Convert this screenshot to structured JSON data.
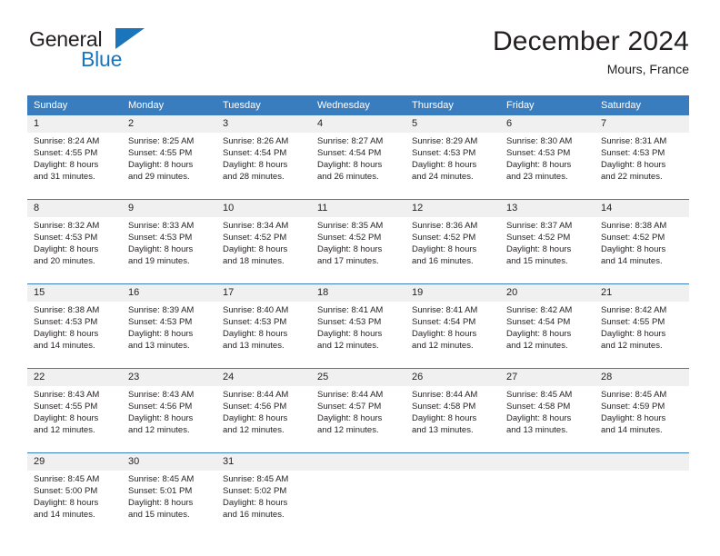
{
  "logo": {
    "word_general": "General",
    "word_blue": "Blue",
    "triangle_color": "#1b75bb"
  },
  "header": {
    "month_title": "December 2024",
    "location": "Mours, France"
  },
  "theme": {
    "header_blue": "#3a7dbf",
    "day_band_gray": "#f0f0f0",
    "text": "#231f20",
    "page_background": "#ffffff"
  },
  "weekdays": [
    "Sunday",
    "Monday",
    "Tuesday",
    "Wednesday",
    "Thursday",
    "Friday",
    "Saturday"
  ],
  "weeks": [
    [
      {
        "day": "1",
        "sunrise": "Sunrise: 8:24 AM",
        "sunset": "Sunset: 4:55 PM",
        "daylight_line1": "Daylight: 8 hours",
        "daylight_line2": "and 31 minutes."
      },
      {
        "day": "2",
        "sunrise": "Sunrise: 8:25 AM",
        "sunset": "Sunset: 4:55 PM",
        "daylight_line1": "Daylight: 8 hours",
        "daylight_line2": "and 29 minutes."
      },
      {
        "day": "3",
        "sunrise": "Sunrise: 8:26 AM",
        "sunset": "Sunset: 4:54 PM",
        "daylight_line1": "Daylight: 8 hours",
        "daylight_line2": "and 28 minutes."
      },
      {
        "day": "4",
        "sunrise": "Sunrise: 8:27 AM",
        "sunset": "Sunset: 4:54 PM",
        "daylight_line1": "Daylight: 8 hours",
        "daylight_line2": "and 26 minutes."
      },
      {
        "day": "5",
        "sunrise": "Sunrise: 8:29 AM",
        "sunset": "Sunset: 4:53 PM",
        "daylight_line1": "Daylight: 8 hours",
        "daylight_line2": "and 24 minutes."
      },
      {
        "day": "6",
        "sunrise": "Sunrise: 8:30 AM",
        "sunset": "Sunset: 4:53 PM",
        "daylight_line1": "Daylight: 8 hours",
        "daylight_line2": "and 23 minutes."
      },
      {
        "day": "7",
        "sunrise": "Sunrise: 8:31 AM",
        "sunset": "Sunset: 4:53 PM",
        "daylight_line1": "Daylight: 8 hours",
        "daylight_line2": "and 22 minutes."
      }
    ],
    [
      {
        "day": "8",
        "sunrise": "Sunrise: 8:32 AM",
        "sunset": "Sunset: 4:53 PM",
        "daylight_line1": "Daylight: 8 hours",
        "daylight_line2": "and 20 minutes."
      },
      {
        "day": "9",
        "sunrise": "Sunrise: 8:33 AM",
        "sunset": "Sunset: 4:53 PM",
        "daylight_line1": "Daylight: 8 hours",
        "daylight_line2": "and 19 minutes."
      },
      {
        "day": "10",
        "sunrise": "Sunrise: 8:34 AM",
        "sunset": "Sunset: 4:52 PM",
        "daylight_line1": "Daylight: 8 hours",
        "daylight_line2": "and 18 minutes."
      },
      {
        "day": "11",
        "sunrise": "Sunrise: 8:35 AM",
        "sunset": "Sunset: 4:52 PM",
        "daylight_line1": "Daylight: 8 hours",
        "daylight_line2": "and 17 minutes."
      },
      {
        "day": "12",
        "sunrise": "Sunrise: 8:36 AM",
        "sunset": "Sunset: 4:52 PM",
        "daylight_line1": "Daylight: 8 hours",
        "daylight_line2": "and 16 minutes."
      },
      {
        "day": "13",
        "sunrise": "Sunrise: 8:37 AM",
        "sunset": "Sunset: 4:52 PM",
        "daylight_line1": "Daylight: 8 hours",
        "daylight_line2": "and 15 minutes."
      },
      {
        "day": "14",
        "sunrise": "Sunrise: 8:38 AM",
        "sunset": "Sunset: 4:52 PM",
        "daylight_line1": "Daylight: 8 hours",
        "daylight_line2": "and 14 minutes."
      }
    ],
    [
      {
        "day": "15",
        "sunrise": "Sunrise: 8:38 AM",
        "sunset": "Sunset: 4:53 PM",
        "daylight_line1": "Daylight: 8 hours",
        "daylight_line2": "and 14 minutes."
      },
      {
        "day": "16",
        "sunrise": "Sunrise: 8:39 AM",
        "sunset": "Sunset: 4:53 PM",
        "daylight_line1": "Daylight: 8 hours",
        "daylight_line2": "and 13 minutes."
      },
      {
        "day": "17",
        "sunrise": "Sunrise: 8:40 AM",
        "sunset": "Sunset: 4:53 PM",
        "daylight_line1": "Daylight: 8 hours",
        "daylight_line2": "and 13 minutes."
      },
      {
        "day": "18",
        "sunrise": "Sunrise: 8:41 AM",
        "sunset": "Sunset: 4:53 PM",
        "daylight_line1": "Daylight: 8 hours",
        "daylight_line2": "and 12 minutes."
      },
      {
        "day": "19",
        "sunrise": "Sunrise: 8:41 AM",
        "sunset": "Sunset: 4:54 PM",
        "daylight_line1": "Daylight: 8 hours",
        "daylight_line2": "and 12 minutes."
      },
      {
        "day": "20",
        "sunrise": "Sunrise: 8:42 AM",
        "sunset": "Sunset: 4:54 PM",
        "daylight_line1": "Daylight: 8 hours",
        "daylight_line2": "and 12 minutes."
      },
      {
        "day": "21",
        "sunrise": "Sunrise: 8:42 AM",
        "sunset": "Sunset: 4:55 PM",
        "daylight_line1": "Daylight: 8 hours",
        "daylight_line2": "and 12 minutes."
      }
    ],
    [
      {
        "day": "22",
        "sunrise": "Sunrise: 8:43 AM",
        "sunset": "Sunset: 4:55 PM",
        "daylight_line1": "Daylight: 8 hours",
        "daylight_line2": "and 12 minutes."
      },
      {
        "day": "23",
        "sunrise": "Sunrise: 8:43 AM",
        "sunset": "Sunset: 4:56 PM",
        "daylight_line1": "Daylight: 8 hours",
        "daylight_line2": "and 12 minutes."
      },
      {
        "day": "24",
        "sunrise": "Sunrise: 8:44 AM",
        "sunset": "Sunset: 4:56 PM",
        "daylight_line1": "Daylight: 8 hours",
        "daylight_line2": "and 12 minutes."
      },
      {
        "day": "25",
        "sunrise": "Sunrise: 8:44 AM",
        "sunset": "Sunset: 4:57 PM",
        "daylight_line1": "Daylight: 8 hours",
        "daylight_line2": "and 12 minutes."
      },
      {
        "day": "26",
        "sunrise": "Sunrise: 8:44 AM",
        "sunset": "Sunset: 4:58 PM",
        "daylight_line1": "Daylight: 8 hours",
        "daylight_line2": "and 13 minutes."
      },
      {
        "day": "27",
        "sunrise": "Sunrise: 8:45 AM",
        "sunset": "Sunset: 4:58 PM",
        "daylight_line1": "Daylight: 8 hours",
        "daylight_line2": "and 13 minutes."
      },
      {
        "day": "28",
        "sunrise": "Sunrise: 8:45 AM",
        "sunset": "Sunset: 4:59 PM",
        "daylight_line1": "Daylight: 8 hours",
        "daylight_line2": "and 14 minutes."
      }
    ],
    [
      {
        "day": "29",
        "sunrise": "Sunrise: 8:45 AM",
        "sunset": "Sunset: 5:00 PM",
        "daylight_line1": "Daylight: 8 hours",
        "daylight_line2": "and 14 minutes."
      },
      {
        "day": "30",
        "sunrise": "Sunrise: 8:45 AM",
        "sunset": "Sunset: 5:01 PM",
        "daylight_line1": "Daylight: 8 hours",
        "daylight_line2": "and 15 minutes."
      },
      {
        "day": "31",
        "sunrise": "Sunrise: 8:45 AM",
        "sunset": "Sunset: 5:02 PM",
        "daylight_line1": "Daylight: 8 hours",
        "daylight_line2": "and 16 minutes."
      },
      {
        "day": "",
        "sunrise": "",
        "sunset": "",
        "daylight_line1": "",
        "daylight_line2": ""
      },
      {
        "day": "",
        "sunrise": "",
        "sunset": "",
        "daylight_line1": "",
        "daylight_line2": ""
      },
      {
        "day": "",
        "sunrise": "",
        "sunset": "",
        "daylight_line1": "",
        "daylight_line2": ""
      },
      {
        "day": "",
        "sunrise": "",
        "sunset": "",
        "daylight_line1": "",
        "daylight_line2": ""
      }
    ]
  ]
}
